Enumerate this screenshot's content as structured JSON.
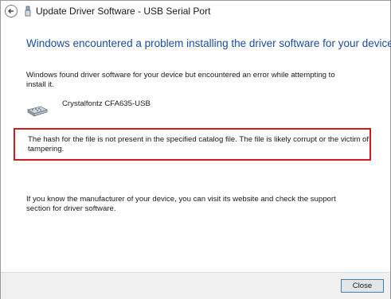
{
  "window": {
    "title": "Update Driver Software - USB Serial Port"
  },
  "content": {
    "heading": "Windows encountered a problem installing the driver software for your device",
    "intro": "Windows found driver software for your device but encountered an error while attempting to install it.",
    "device_name": "Crystalfontz CFA635-USB",
    "error_message": "The hash for the file is not present in the specified catalog file. The file is likely corrupt or the victim of tampering.",
    "help_text": "If you know the manufacturer of your device, you can visit its website and check the support section for driver software."
  },
  "footer": {
    "close_label": "Close"
  },
  "colors": {
    "heading": "#1d4ea1",
    "error_border": "#d11a1a",
    "footer_bg": "#f0f0f0"
  },
  "icons": {
    "back": "back-arrow-icon",
    "title": "driver-icon",
    "device": "usb-serial-device-icon"
  }
}
